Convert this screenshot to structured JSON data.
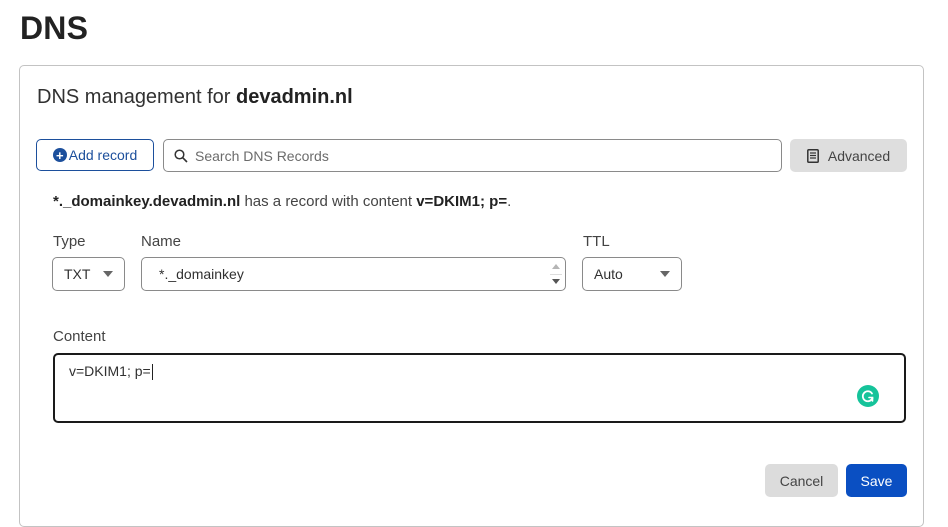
{
  "page": {
    "title": "DNS"
  },
  "card": {
    "title_prefix": "DNS management for",
    "title_domain": "devadmin.nl"
  },
  "toolbar": {
    "add_record_label": "Add record",
    "search_placeholder": "Search DNS Records",
    "search_value": "",
    "advanced_label": "Advanced"
  },
  "summary": {
    "record_name": "*._domainkey.devadmin.nl",
    "middle_text": "has a record with content",
    "record_content": "v=DKIM1; p=",
    "end": "."
  },
  "form": {
    "type_label": "Type",
    "type_value": "TXT",
    "name_label": "Name",
    "name_value": "*._domainkey",
    "ttl_label": "TTL",
    "ttl_value": "Auto",
    "content_label": "Content",
    "content_value": "v=DKIM1; p="
  },
  "actions": {
    "cancel_label": "Cancel",
    "save_label": "Save"
  },
  "colors": {
    "primary": "#0a4fc2",
    "outline_blue": "#1c4f9c",
    "grammarly": "#15c39a"
  }
}
